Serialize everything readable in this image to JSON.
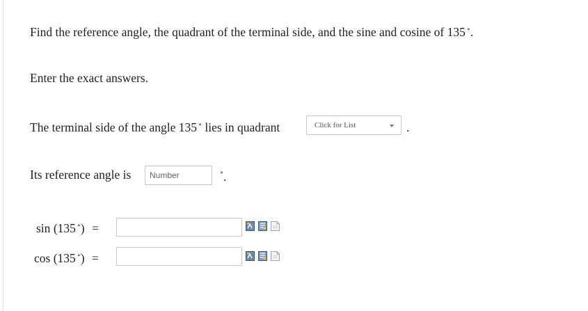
{
  "question": {
    "prompt": "Find the reference angle, the quadrant of the terminal side, and the sine and cosine of 135",
    "prompt_deg": "∘",
    "prompt_end": ".",
    "instruction": "Enter the exact answers."
  },
  "quadrant": {
    "text": "The terminal side of the angle 135",
    "deg": "∘",
    "text_after": " lies in quadrant",
    "select_placeholder": "Click for List",
    "trailing": "."
  },
  "reference": {
    "text": "Its reference angle is",
    "placeholder": "Number",
    "deg": "∘",
    "trailing": "."
  },
  "sin": {
    "fn": "sin",
    "open": "(135",
    "deg": "∘",
    "close": ")",
    "equals": "="
  },
  "cos": {
    "fn": "cos",
    "open": "(135",
    "deg": "∘",
    "close": ")",
    "equals": "="
  },
  "tools": [
    "equation-editor-icon",
    "preview-icon",
    "help-icon"
  ]
}
